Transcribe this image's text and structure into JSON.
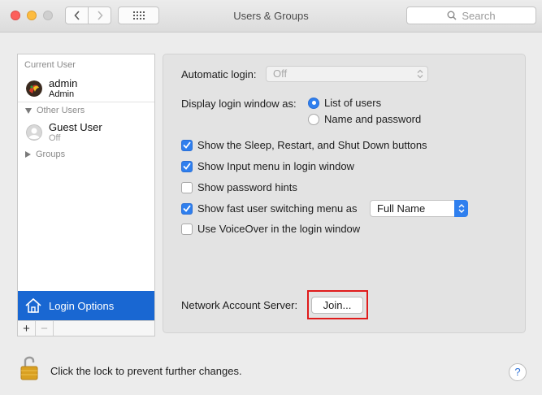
{
  "window": {
    "title": "Users & Groups",
    "search_placeholder": "Search"
  },
  "sidebar": {
    "current_user_header": "Current User",
    "current_user": {
      "name": "admin",
      "role": "Admin"
    },
    "other_users_header": "Other Users",
    "guest_user": {
      "name": "Guest User",
      "status": "Off"
    },
    "groups_label": "Groups",
    "login_options_label": "Login Options",
    "add_symbol": "+",
    "remove_symbol": "−"
  },
  "panel": {
    "automatic_login_label": "Automatic login:",
    "automatic_login_value": "Off",
    "display_login_label": "Display login window as:",
    "display_options": [
      {
        "label": "List of users",
        "selected": true
      },
      {
        "label": "Name and password",
        "selected": false
      }
    ],
    "checkboxes": [
      {
        "label": "Show the Sleep, Restart, and Shut Down buttons",
        "checked": true
      },
      {
        "label": "Show Input menu in login window",
        "checked": true
      },
      {
        "label": "Show password hints",
        "checked": false
      },
      {
        "label": "Show fast user switching menu as",
        "checked": true
      },
      {
        "label": "Use VoiceOver in the login window",
        "checked": false
      }
    ],
    "fast_switch_value": "Full Name",
    "network_server_label": "Network Account Server:",
    "join_label": "Join..."
  },
  "footer": {
    "lock_text": "Click the lock to prevent further changes.",
    "help_symbol": "?"
  },
  "colors": {
    "accent": "#2f7fee",
    "selection": "#1967d2",
    "highlight_box": "#e01b1b"
  }
}
